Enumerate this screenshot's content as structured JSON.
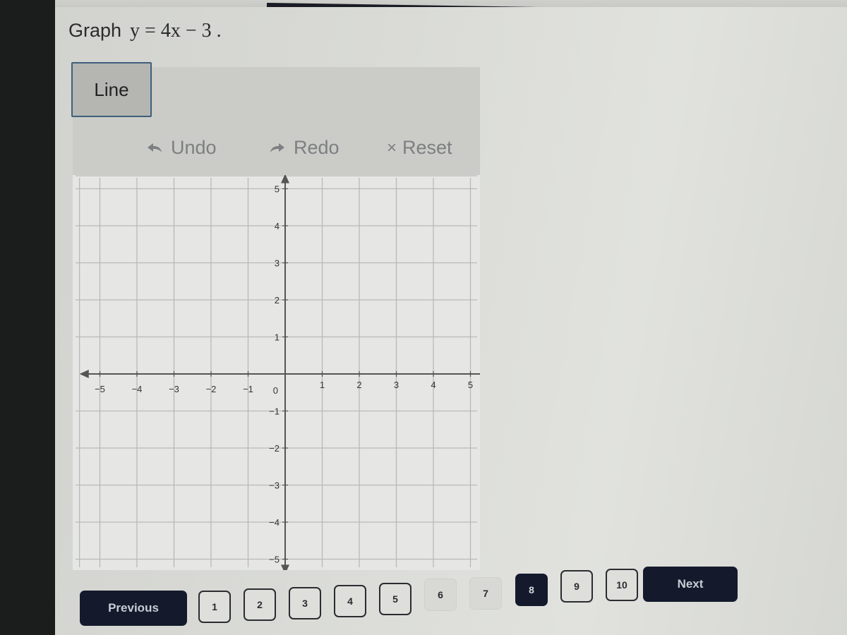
{
  "question": {
    "prefix": "Graph",
    "equation": "y = 4x − 3 ."
  },
  "toolbar": {
    "tool_label": "Line",
    "undo_label": "Undo",
    "redo_label": "Redo",
    "reset_label": "Reset",
    "reset_icon": "×"
  },
  "graph": {
    "x_range": [
      -5,
      5
    ],
    "y_range": [
      -5,
      5
    ],
    "x_ticks": [
      "−5",
      "−4",
      "−3",
      "−2",
      "−1",
      "1",
      "2",
      "3",
      "4",
      "5"
    ],
    "y_ticks": [
      "5",
      "4",
      "3",
      "2",
      "1",
      "−1",
      "−2",
      "−3",
      "−4",
      "−5"
    ],
    "origin_label": "0",
    "plotted_points": []
  },
  "pagination": {
    "previous_label": "Previous",
    "next_label": "Next",
    "pages": [
      "1",
      "2",
      "3",
      "4",
      "5",
      "6",
      "7",
      "8",
      "9",
      "10"
    ],
    "current_page": "8",
    "answered_pages": [
      "1",
      "2",
      "3",
      "4",
      "5",
      "9",
      "10"
    ],
    "unvisited_pages": [
      "6",
      "7"
    ]
  },
  "colors": {
    "nav_button": "#141a2c",
    "tool_selected_border": "#3f5f7b",
    "grid_line": "#b9bab6",
    "axis": "#555555"
  }
}
